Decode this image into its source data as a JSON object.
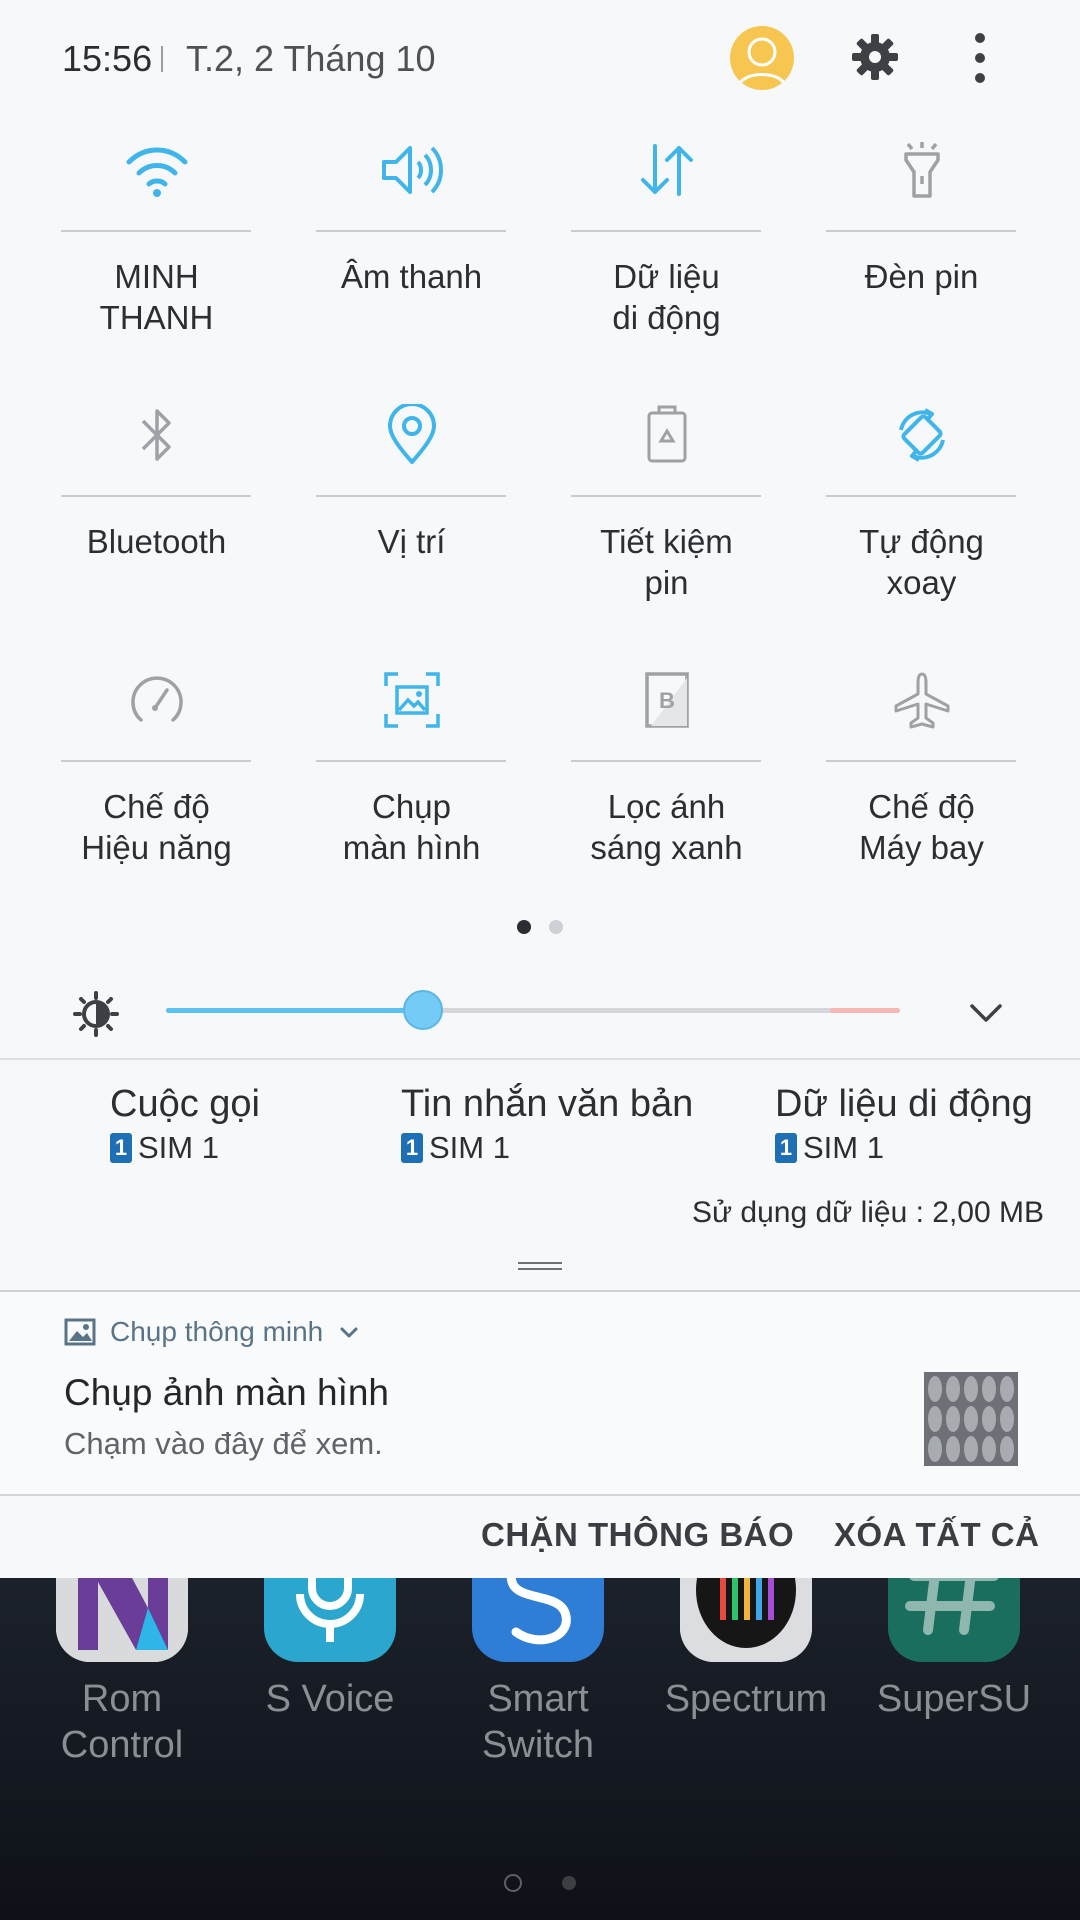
{
  "status_bar": {
    "time": "15:56",
    "date": "T.2, 2 Tháng 10"
  },
  "colors": {
    "accent_blue": "#3fb5ea",
    "inactive_gray": "#9ea2a6",
    "avatar_yellow": "#f6c650"
  },
  "tiles": [
    {
      "label": "MINH\nTHANH",
      "icon": "wifi-icon",
      "active": true
    },
    {
      "label": "Âm thanh",
      "icon": "volume-icon",
      "active": true
    },
    {
      "label": "Dữ liệu\ndi động",
      "icon": "mobile-data-icon",
      "active": true
    },
    {
      "label": "Đèn pin",
      "icon": "flashlight-icon",
      "active": false
    },
    {
      "label": "Bluetooth",
      "icon": "bluetooth-icon",
      "active": false
    },
    {
      "label": "Vị trí",
      "icon": "location-icon",
      "active": true
    },
    {
      "label": "Tiết kiệm\npin",
      "icon": "battery-saver-icon",
      "active": false
    },
    {
      "label": "Tự động\nxoay",
      "icon": "auto-rotate-icon",
      "active": true
    },
    {
      "label": "Chế độ\nHiệu năng",
      "icon": "performance-mode-icon",
      "active": false
    },
    {
      "label": "Chụp\nmàn hình",
      "icon": "screenshot-icon",
      "active": true
    },
    {
      "label": "Lọc ánh\nsáng xanh",
      "icon": "blue-light-filter-icon",
      "active": false
    },
    {
      "label": "Chế độ\nMáy bay",
      "icon": "airplane-icon",
      "active": false
    }
  ],
  "pager": {
    "pages": 2,
    "current": 1
  },
  "brightness": {
    "level": 0.35
  },
  "sim_info": [
    {
      "title": "Cuộc gọi",
      "badge": "1",
      "sim": "SIM 1"
    },
    {
      "title": "Tin nhắn văn bản",
      "badge": "1",
      "sim": "SIM 1"
    },
    {
      "title": "Dữ liệu di động",
      "badge": "1",
      "sim": "SIM 1"
    }
  ],
  "data_usage": "Sử dụng dữ liệu : 2,00 MB",
  "notification": {
    "app_name": "Chụp thông minh",
    "title": "Chụp ảnh màn hình",
    "text": "Chạm vào đây để xem."
  },
  "actions": {
    "block": "CHẶN THÔNG BÁO",
    "clear": "XÓA TẤT CẢ"
  },
  "home_apps": [
    {
      "label": "Rom Control",
      "icon": "rom-control-icon"
    },
    {
      "label": "S Voice",
      "icon": "s-voice-icon"
    },
    {
      "label": "Smart\nSwitch",
      "icon": "smart-switch-icon"
    },
    {
      "label": "Spectrum",
      "icon": "spectrum-icon"
    },
    {
      "label": "SuperSU",
      "icon": "supersu-icon"
    }
  ]
}
